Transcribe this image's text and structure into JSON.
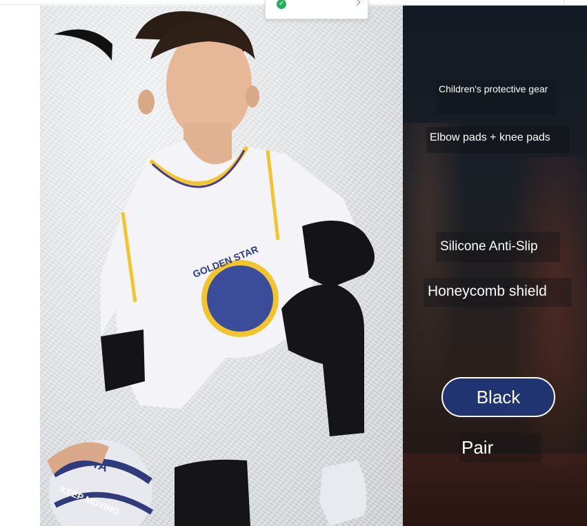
{
  "product_text": {
    "line1": "Children's protective gear",
    "line2": "Elbow pads + knee pads",
    "line3": "Silicone Anti-Slip",
    "line4": "Honeycomb shield",
    "color_option": "Black",
    "quantity": "Pair"
  },
  "photo_text": {
    "jersey": "GOLDEN STAR",
    "ball": "ANTA",
    "ball_slogan": "KEEP MOVING"
  },
  "colors": {
    "pill": "#1f3470",
    "panel": "#161b22",
    "toast_check": "#27ae60"
  },
  "icons": [
    "check-icon",
    "anta-logo-icon"
  ]
}
